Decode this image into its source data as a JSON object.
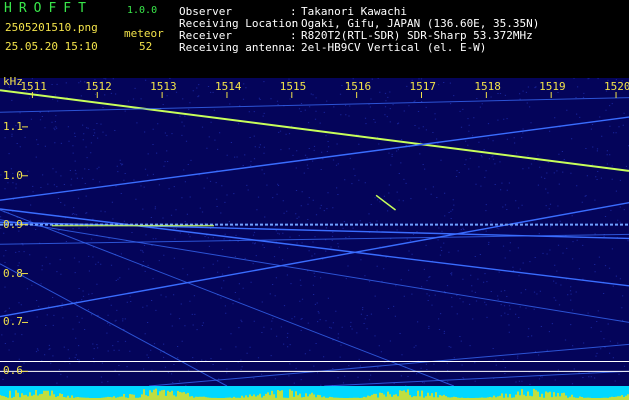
{
  "header": {
    "app_name": "HROFFT",
    "version": "1.0.0",
    "filename": "2505201510.png",
    "meteor_label": "meteor",
    "datetime": "25.05.20 15:10",
    "meteor_count": "52",
    "info": [
      {
        "label": "Observer",
        "value": "Takanori Kawachi"
      },
      {
        "label": "Receiving Location",
        "value": "Ogaki, Gifu, JAPAN (136.60E, 35.35N)"
      },
      {
        "label": "Receiver",
        "value": "R820T2(RTL-SDR) SDR-Sharp 53.372MHz"
      },
      {
        "label": "Receiving antenna",
        "value": "2el-HB9CV Vertical (el. E-W)"
      }
    ]
  },
  "chart_data": {
    "type": "heatmap",
    "x_unit": "",
    "y_unit": "kHz",
    "x_ticks": [
      "1511",
      "1512",
      "1513",
      "1514",
      "1515",
      "1516",
      "1517",
      "1518",
      "1519",
      "1520"
    ],
    "y_ticks": [
      "1.1",
      "1.0",
      "0.9",
      "0.8",
      "0.7",
      "0.6"
    ],
    "xlim": [
      1510.5,
      1520.2
    ],
    "ylim": [
      0.57,
      1.2
    ],
    "colors": {
      "background": "#04045a",
      "trace": "#3a6dff",
      "strong": "#c8ff5a",
      "meteor": "#ffe000",
      "floor": "#00d8ff"
    },
    "traces": [
      {
        "strength": "strong",
        "points": [
          [
            1510.5,
            1.175
          ],
          [
            1520.2,
            1.01
          ]
        ]
      },
      {
        "strength": "medium",
        "points": [
          [
            1510.5,
            0.905
          ],
          [
            1520.2,
            0.872
          ]
        ]
      },
      {
        "strength": "medium",
        "points": [
          [
            1510.5,
            0.932
          ],
          [
            1520.2,
            0.775
          ]
        ]
      },
      {
        "strength": "medium",
        "points": [
          [
            1510.5,
            0.95
          ],
          [
            1520.2,
            1.12
          ]
        ]
      },
      {
        "strength": "medium",
        "points": [
          [
            1510.5,
            0.712
          ],
          [
            1520.2,
            0.945
          ]
        ]
      },
      {
        "strength": "weak",
        "points": [
          [
            1510.5,
            0.93
          ],
          [
            1517.5,
            0.57
          ]
        ]
      },
      {
        "strength": "weak",
        "points": [
          [
            1510.5,
            0.82
          ],
          [
            1514.0,
            0.57
          ]
        ]
      },
      {
        "strength": "weak",
        "points": [
          [
            1512.8,
            0.57
          ],
          [
            1520.2,
            0.655
          ]
        ]
      },
      {
        "strength": "weak",
        "points": [
          [
            1510.5,
            0.91
          ],
          [
            1520.2,
            0.7
          ]
        ]
      },
      {
        "strength": "weak",
        "points": [
          [
            1510.5,
            1.13
          ],
          [
            1520.2,
            1.16
          ]
        ]
      },
      {
        "strength": "weak",
        "points": [
          [
            1510.5,
            0.86
          ],
          [
            1520.2,
            0.88
          ]
        ]
      },
      {
        "strength": "weak",
        "points": [
          [
            1515.5,
            0.57
          ],
          [
            1520.2,
            0.6
          ]
        ]
      }
    ],
    "meteor_band": {
      "y": 0.9,
      "x_range": [
        1510.5,
        1520.2
      ]
    },
    "reference_lines": [
      0.62,
      0.6
    ]
  }
}
